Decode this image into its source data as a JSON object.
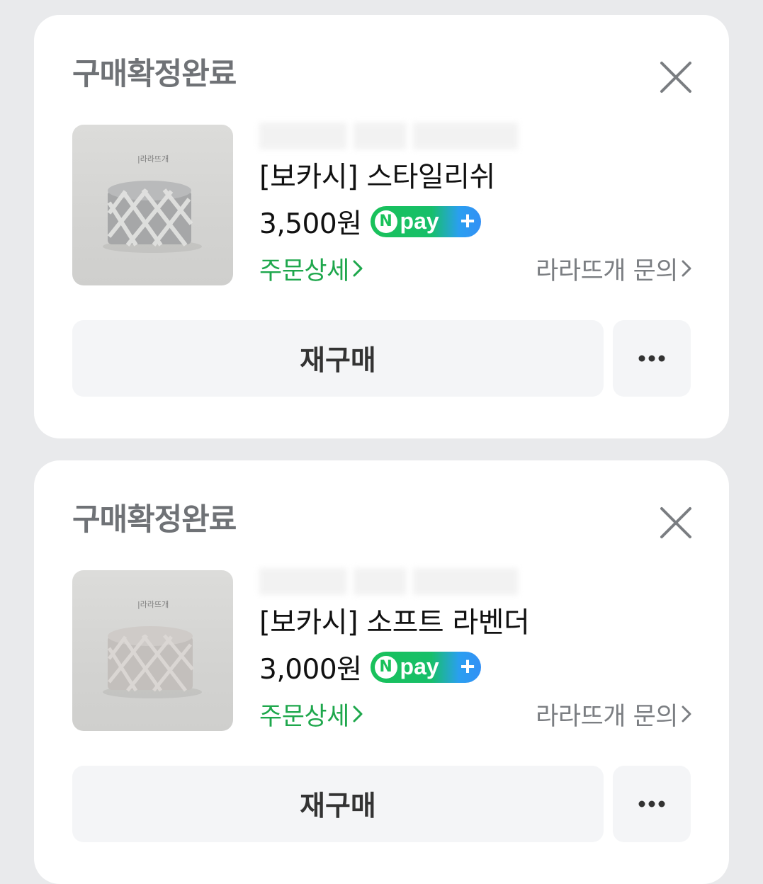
{
  "orders": [
    {
      "status": "구매확정완료",
      "product_name": "[보카시] 스타일리쉬",
      "price": "3,500원",
      "npay": {
        "n": "N",
        "pay": "pay",
        "plus": "+"
      },
      "detail_link": "주문상세",
      "inquiry_link": "라라뜨개 문의",
      "rebuy_label": "재구매",
      "thumb_brand": "|라라뜨개"
    },
    {
      "status": "구매확정완료",
      "product_name": "[보카시] 소프트 라벤더",
      "price": "3,000원",
      "npay": {
        "n": "N",
        "pay": "pay",
        "plus": "+"
      },
      "detail_link": "주문상세",
      "inquiry_link": "라라뜨개 문의",
      "rebuy_label": "재구매",
      "thumb_brand": "|라라뜨개"
    }
  ],
  "colors": {
    "background": "#e9eaec",
    "card": "#ffffff",
    "status_text": "#6f7276",
    "accent_green": "#1ea74c",
    "npay_green": "#19c15a",
    "npay_blue": "#3390f5",
    "button_bg": "#f4f5f7"
  },
  "icons": {
    "close": "close-icon",
    "more": "more-horizontal-icon",
    "chevron": "chevron-right-icon"
  }
}
